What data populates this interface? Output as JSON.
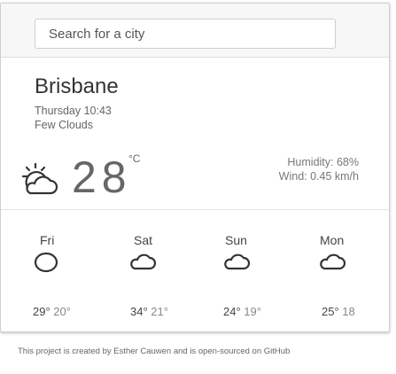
{
  "search": {
    "placeholder": "Search for a city",
    "value": ""
  },
  "current": {
    "city": "Brisbane",
    "datetime": "Thursday 10:43",
    "description": "Few Clouds",
    "temperature": "28",
    "unit": "°C",
    "humidity": "Humidity: 68%",
    "wind": "Wind: 0.45 km/h",
    "icon": "few-clouds-sun-icon"
  },
  "forecast": [
    {
      "day": "Fri",
      "max": "29°",
      "min": "20°",
      "icon": "cloud-icon"
    },
    {
      "day": "Sat",
      "max": "34°",
      "min": "21°",
      "icon": "cloud-icon"
    },
    {
      "day": "Sun",
      "max": "24°",
      "min": "19°",
      "icon": "cloud-icon"
    },
    {
      "day": "Mon",
      "max": "25°",
      "min": "18",
      "icon": "cloud-icon"
    }
  ],
  "footer": {
    "text": "This project is created by Esther Cauwen and is open-sourced on GitHub"
  },
  "colors": {
    "text": "#444444",
    "muted": "#888888",
    "border": "#cfcfcf"
  }
}
